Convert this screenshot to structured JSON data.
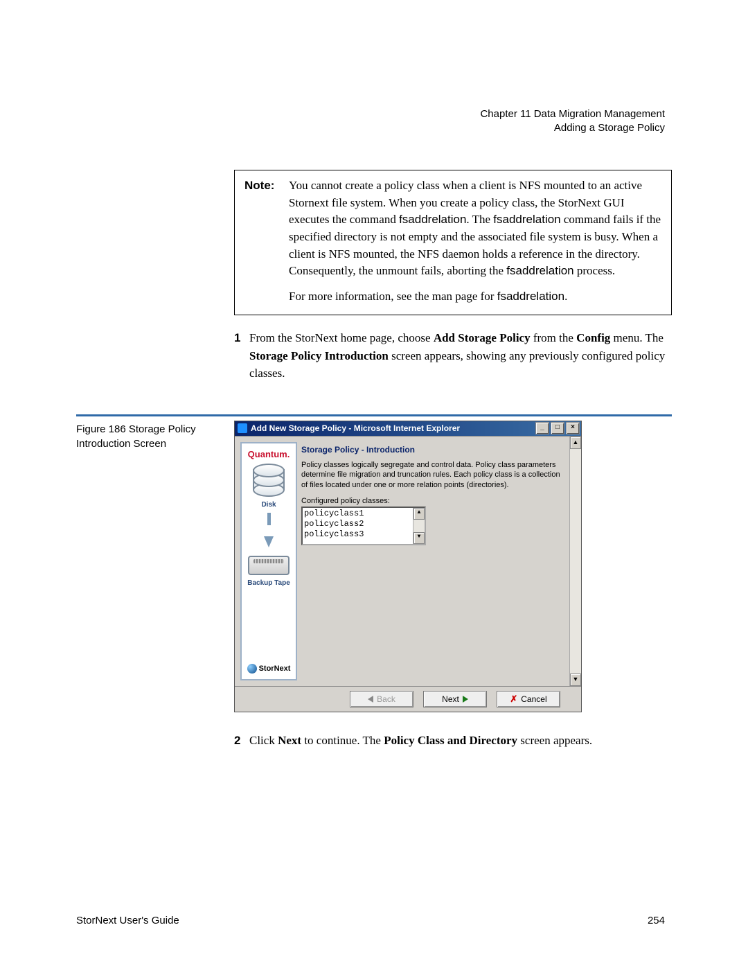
{
  "header": {
    "chapter": "Chapter 11  Data Migration Management",
    "section": "Adding a Storage Policy"
  },
  "note": {
    "label": "Note:",
    "para1_a": "You cannot create a policy class when a client is NFS mounted to an active Stornext file system. When you create a policy class, the StorNext GUI executes the command ",
    "cmd1": "fsaddrelation",
    "para1_b": ". The ",
    "cmd2": "fsaddrelation",
    "para1_c": " command fails if the specified directory is not empty and the associated file system is busy. When a client is NFS mounted, the NFS daemon holds a reference in the directory. Consequently, the unmount fails, aborting the ",
    "cmd3": "fsaddrelation",
    "para1_d": " process.",
    "para2_a": "For more information, see the man page for ",
    "cmd4": "fsaddrelation",
    "para2_b": "."
  },
  "step1": {
    "num": "1",
    "a": "From the StorNext home page, choose ",
    "b1": "Add Storage Policy",
    "c": " from the ",
    "b2": "Config",
    "d": " menu. The ",
    "b3": "Storage Policy Introduction",
    "e": " screen appears, showing any previously configured policy classes."
  },
  "figure": {
    "caption": "Figure 186  Storage Policy Introduction Screen"
  },
  "window": {
    "title": "Add New Storage Policy - Microsoft Internet Explorer",
    "min": "_",
    "max": "□",
    "close": "×",
    "sidebar": {
      "brand": "Quantum.",
      "disk": "Disk",
      "tape": "Backup Tape",
      "product": "StorNext"
    },
    "panel": {
      "title": "Storage Policy - Introduction",
      "desc": "Policy classes logically segregate and control data. Policy class parameters determine file migration and truncation rules. Each policy class is a collection of files located under one or more relation points (directories).",
      "configured_label": "Configured policy classes:",
      "items": [
        "policyclass1",
        "policyclass2",
        "policyclass3"
      ]
    },
    "buttons": {
      "back": "Back",
      "next": "Next",
      "cancel": "Cancel"
    }
  },
  "step2": {
    "num": "2",
    "a": "Click ",
    "b1": "Next",
    "c": " to continue. The ",
    "b2": "Policy Class and Directory",
    "d": " screen appears."
  },
  "footer": {
    "left": "StorNext User's Guide",
    "right": "254"
  }
}
